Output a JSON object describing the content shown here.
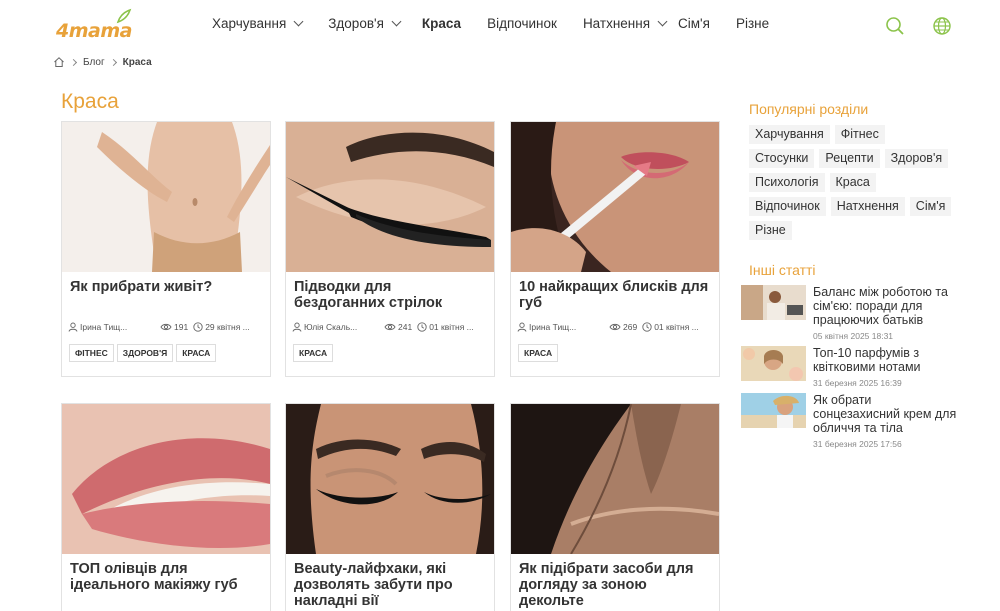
{
  "header": {
    "logo_text": "4mama",
    "nav": [
      {
        "label": "Харчування",
        "dropdown": true,
        "active": false
      },
      {
        "label": "Здоров'я",
        "dropdown": true,
        "active": false
      },
      {
        "label": "Краса",
        "dropdown": false,
        "active": true
      },
      {
        "label": "Відпочинок",
        "dropdown": false,
        "active": false
      },
      {
        "label": "Натхнення",
        "dropdown": true,
        "active": false
      },
      {
        "label": "Сім'я",
        "dropdown": false,
        "active": false
      },
      {
        "label": "Різне",
        "dropdown": false,
        "active": false
      }
    ],
    "icons": [
      "search-icon",
      "globe-icon"
    ]
  },
  "breadcrumb": {
    "home_icon": "home-icon",
    "items": [
      "Блог",
      "Краса"
    ]
  },
  "page_title": "Краса",
  "articles": [
    {
      "title": "Як прибрати живіт?",
      "author": "Ірина Тищ...",
      "views": "191",
      "date": "29 квітня ...",
      "tags": [
        "ФІТНЕС",
        "ЗДОРОВ'Я",
        "КРАСА"
      ]
    },
    {
      "title": "Підводки для бездоганних стрілок",
      "author": "Юлія Скаль...",
      "views": "241",
      "date": "01 квітня ...",
      "tags": [
        "КРАСА"
      ]
    },
    {
      "title": "10 найкращих блисків для губ",
      "author": "Ірина Тищ...",
      "views": "269",
      "date": "01 квітня ...",
      "tags": [
        "КРАСА"
      ]
    },
    {
      "title": "ТОП олівців для ідеального макіяжу губ"
    },
    {
      "title": "Beauty-лайфхаки, які дозволять забути про накладні вії"
    },
    {
      "title": "Як підібрати засоби для догляду за зоною декольте"
    }
  ],
  "sidebar": {
    "popular_heading": "Популярні розділи",
    "popular": [
      "Харчування",
      "Фітнес",
      "Стосунки",
      "Рецепти",
      "Здоров'я",
      "Психологія",
      "Краса",
      "Відпочинок",
      "Натхнення",
      "Сім'я",
      "Різне"
    ],
    "other_heading": "Інші статті",
    "other": [
      {
        "title": "Баланс між роботою та сім'єю: поради для працюючих батьків",
        "date": "05 квітня 2025 18:31"
      },
      {
        "title": "Топ-10 парфумів з квітковими нотами",
        "date": "31 березня 2025 16:39"
      },
      {
        "title": "Як обрати сонцезахисний крем для обличчя та тіла",
        "date": "31 березня 2025 17:56"
      }
    ]
  },
  "colors": {
    "accent": "#e8a23a",
    "green": "#8bc34a",
    "text": "#333333"
  }
}
